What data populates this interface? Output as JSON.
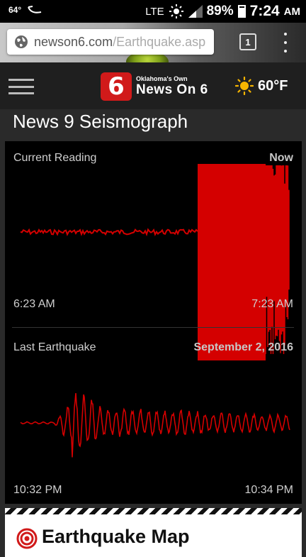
{
  "status_bar": {
    "temperature": "64°",
    "network": "LTE",
    "battery": "89%",
    "time": "7:24",
    "ampm": "AM"
  },
  "browser": {
    "url_host": "newson6.com",
    "url_path": "/Earthquake.asp",
    "tab_count": "1"
  },
  "header": {
    "logo_badge": "6",
    "logo_small": "Oklahoma's Own",
    "logo_big": "News On 6",
    "weather_icon": "sun-icon",
    "weather_temp": "60°F"
  },
  "page": {
    "title": "News 9 Seismograph"
  },
  "seismograph": {
    "accent_color": "#d40000",
    "current": {
      "label": "Current Reading",
      "right_label": "Now",
      "start_time": "6:23 AM",
      "end_time": "7:23 AM"
    },
    "last": {
      "label": "Last Earthquake",
      "date": "September 2, 2016",
      "start_time": "10:32 PM",
      "end_time": "10:34 PM"
    }
  },
  "map_card": {
    "icon": "target-icon",
    "title": "Earthquake Map"
  }
}
